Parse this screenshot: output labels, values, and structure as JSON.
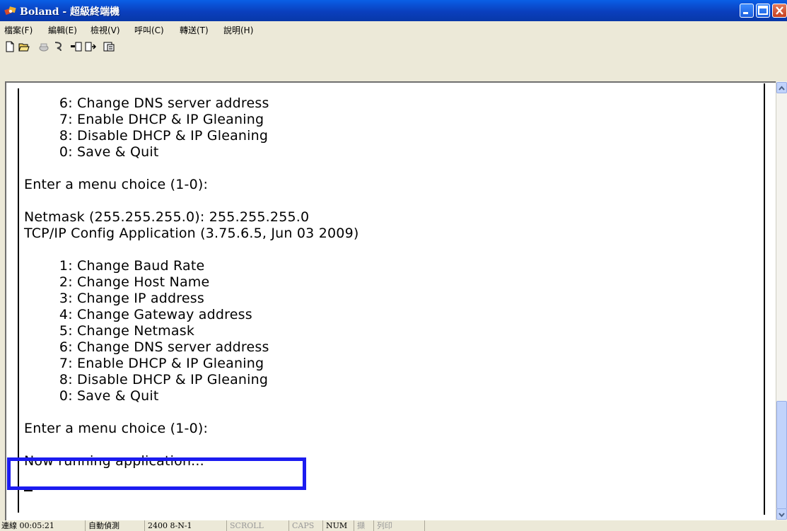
{
  "window": {
    "title": "Boland - 超級終端機",
    "controls": {
      "minimize": "minimize",
      "maximize": "maximize",
      "close": "close"
    }
  },
  "menu": [
    "檔案(F)",
    "編輯(E)",
    "檢視(V)",
    "呼叫(C)",
    "轉送(T)",
    "說明(H)"
  ],
  "toolbar": {
    "icons": [
      "new-connection-icon",
      "open-icon",
      "call-icon",
      "disconnect-icon",
      "send-icon",
      "receive-icon",
      "properties-icon"
    ]
  },
  "terminal": {
    "lines": [
      "        6: Change DNS server address",
      "        7: Enable DHCP & IP Gleaning",
      "        8: Disable DHCP & IP Gleaning",
      "        0: Save & Quit",
      "",
      "Enter a menu choice (1-0):",
      "",
      "Netmask (255.255.255.0): 255.255.255.0",
      "TCP/IP Config Application (3.75.6.5, Jun 03 2009)",
      "",
      "        1: Change Baud Rate",
      "        2: Change Host Name",
      "        3: Change IP address",
      "        4: Change Gateway address",
      "        5: Change Netmask",
      "        6: Change DNS server address",
      "        7: Enable DHCP & IP Gleaning",
      "        8: Disable DHCP & IP Gleaning",
      "        0: Save & Quit",
      "",
      "Enter a menu choice (1-0):",
      "",
      "Now running application..."
    ],
    "highlight_color": "#1c1cf0"
  },
  "status": {
    "connected": "連線 00:05:21",
    "detect": "自動偵測",
    "settings": "2400 8-N-1",
    "scroll": "SCROLL",
    "caps": "CAPS",
    "num": "NUM",
    "capture": "擷",
    "print": "列印"
  }
}
